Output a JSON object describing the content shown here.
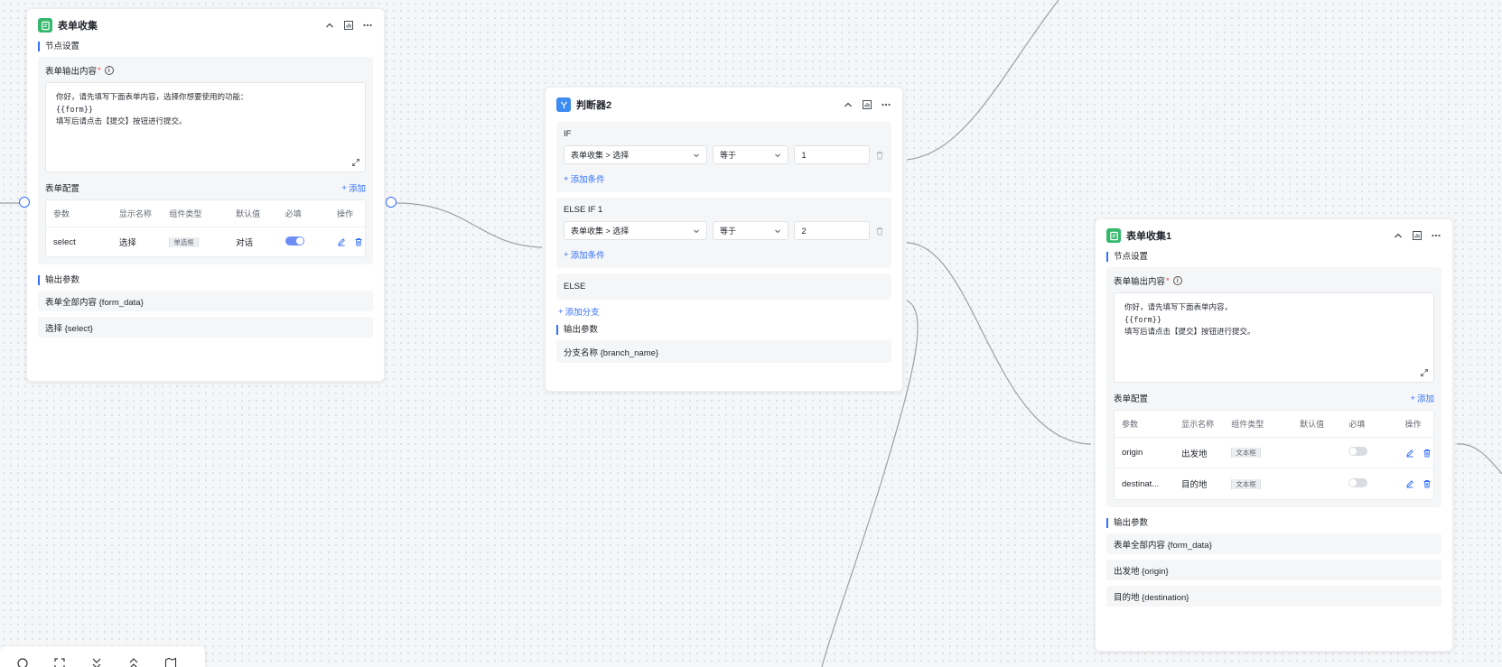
{
  "node_a": {
    "title": "表单收集",
    "settings_label": "节点设置",
    "output_content_label": "表单输出内容",
    "required_mark": "*",
    "editor_lines": [
      "你好，请先填写下面表单内容，选择你想要使用的功能：",
      "{{form}}",
      "填写后请点击【提交】按钮进行提交。"
    ],
    "config_label": "表单配置",
    "add_label": "添加",
    "table_headers": [
      "参数",
      "显示名称",
      "组件类型",
      "默认值",
      "必填",
      "操作"
    ],
    "rows": [
      {
        "param": "select",
        "display": "选择",
        "type": "单选框",
        "default": "对话",
        "required": true
      }
    ],
    "output_label": "输出参数",
    "outputs": [
      "表单全部内容 {form_data}",
      "选择 {select}"
    ]
  },
  "node_b": {
    "title": "判断器2",
    "branches": [
      {
        "label": "IF",
        "field": "表单收集 > 选择",
        "op": "等于",
        "value": "1",
        "add_cond": "添加条件"
      },
      {
        "label": "ELSE IF 1",
        "field": "表单收集 > 选择",
        "op": "等于",
        "value": "2",
        "add_cond": "添加条件"
      }
    ],
    "else_label": "ELSE",
    "add_branch": "添加分支",
    "output_label": "输出参数",
    "outputs": [
      "分支名称 {branch_name}"
    ]
  },
  "node_c": {
    "title": "表单收集1",
    "settings_label": "节点设置",
    "output_content_label": "表单输出内容",
    "required_mark": "*",
    "editor_lines": [
      "你好，请先填写下面表单内容，",
      "{{form}}",
      "填写后请点击【提交】按钮进行提交。"
    ],
    "config_label": "表单配置",
    "add_label": "添加",
    "table_headers": [
      "参数",
      "显示名称",
      "组件类型",
      "默认值",
      "必填",
      "操作"
    ],
    "rows": [
      {
        "param": "origin",
        "display": "出发地",
        "type": "文本框",
        "default": "",
        "required": false
      },
      {
        "param": "destinat...",
        "display": "目的地",
        "type": "文本框",
        "default": "",
        "required": false
      }
    ],
    "output_label": "输出参数",
    "outputs": [
      "表单全部内容 {form_data}",
      "出发地 {origin}",
      "目的地 {destination}"
    ]
  },
  "colors": {
    "accent": "#3370ff",
    "form_icon": "#34b86c",
    "judge_icon": "#3c8cf2"
  },
  "toolbar_icons": [
    "zoom-icon",
    "fit-view-icon",
    "collapse-all-icon",
    "expand-all-icon",
    "map-icon"
  ]
}
